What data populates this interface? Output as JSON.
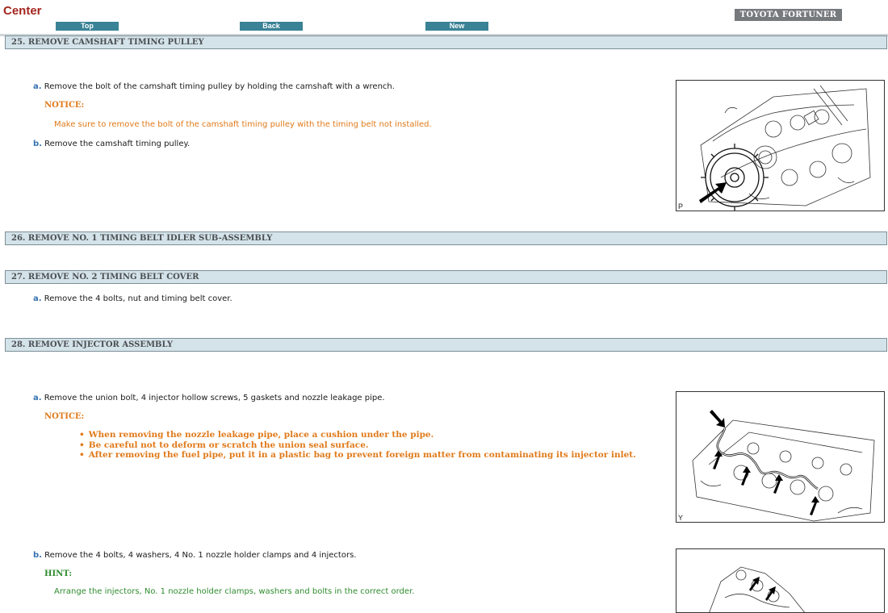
{
  "header": {
    "brand": "Center",
    "nav": {
      "top": "Top",
      "back": "Back",
      "new": "New"
    },
    "vehicle": "TOYOTA FORTUNER"
  },
  "sections": [
    {
      "title": "25. REMOVE CAMSHAFT TIMING PULLEY",
      "steps": [
        {
          "letter": "a.",
          "text": "Remove the bolt of the camshaft timing pulley by holding the camshaft with a wrench.",
          "notice_label": "NOTICE:",
          "notice_text": "Make sure to remove the bolt of the camshaft timing pulley with the timing belt not installed."
        },
        {
          "letter": "b.",
          "text": "Remove the camshaft timing pulley."
        }
      ],
      "figure": {
        "code": "P",
        "icon": "camshaft-pulley-illustration"
      }
    },
    {
      "title": "26. REMOVE NO. 1 TIMING BELT IDLER SUB-ASSEMBLY"
    },
    {
      "title": "27. REMOVE NO. 2 TIMING BELT COVER",
      "steps": [
        {
          "letter": "a.",
          "text": "Remove the 4 bolts, nut and timing belt cover."
        }
      ]
    },
    {
      "title": "28. REMOVE INJECTOR ASSEMBLY",
      "steps": [
        {
          "letter": "a.",
          "text": "Remove the union bolt, 4 injector hollow screws, 5 gaskets and nozzle leakage pipe.",
          "notice_label": "NOTICE:",
          "notice_bullets": [
            "When removing the nozzle leakage pipe, place a cushion under the pipe.",
            "Be careful not to deform or scratch the union seal surface.",
            "After removing the fuel pipe, put it in a plastic bag to prevent foreign matter from contaminating its injector inlet."
          ],
          "figure": {
            "code": "Y",
            "icon": "nozzle-leakage-pipe-illustration"
          }
        },
        {
          "letter": "b.",
          "text": "Remove the 4 bolts, 4 washers, 4 No. 1 nozzle holder clamps and 4 injectors.",
          "hint_label": "HINT:",
          "hint_text": "Arrange the injectors, No. 1 nozzle holder clamps, washers and bolts in the correct order.",
          "figure": {
            "icon": "injector-removal-illustration"
          }
        }
      ]
    }
  ],
  "colors": {
    "section_bg": "#d4e3e9",
    "nav_button": "#3a8296",
    "notice": "#e07a1a",
    "hint": "#2f8c2f",
    "step_letter": "#3572b0",
    "brand": "#a3261f"
  }
}
